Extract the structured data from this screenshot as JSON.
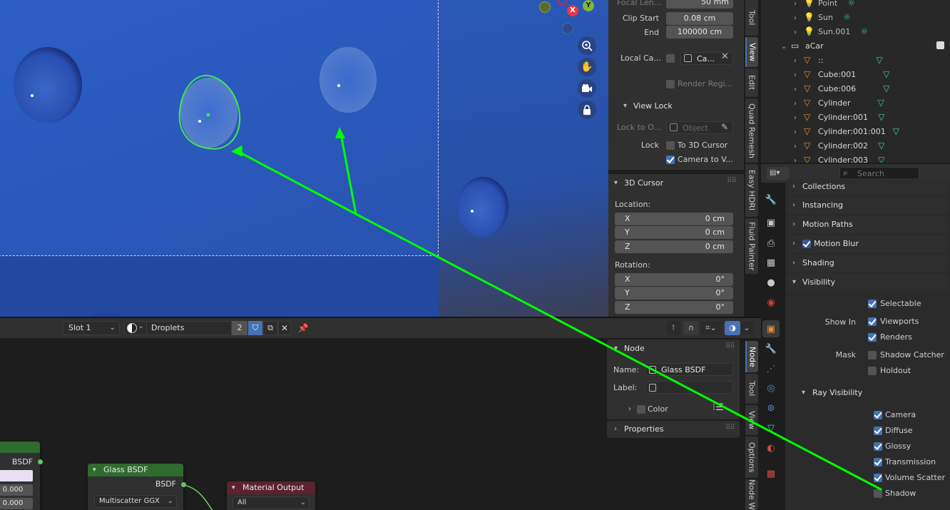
{
  "viewport": {
    "gizmo_x_label": "X",
    "gizmo_y_label": "Y"
  },
  "view_panel": {
    "focal_length_label": "Focal Len...",
    "focal_length_value": "50 mm",
    "clip_start_label": "Clip Start",
    "clip_start_value": "0.08 cm",
    "clip_end_label": "End",
    "clip_end_value": "100000 cm",
    "local_camera_label": "Local Ca...",
    "local_camera_value": "Ca...",
    "render_region_label": "Render Regi...",
    "view_lock_header": "View Lock",
    "lock_to_object_label": "Lock to O...",
    "lock_to_object_placeholder": "Object",
    "lock_label": "Lock",
    "to_3d_cursor_label": "To 3D Cursor",
    "camera_to_view_label": "Camera to V...",
    "cursor_header": "3D Cursor",
    "location_label": "Location:",
    "location": [
      {
        "axis": "X",
        "value": "0 cm"
      },
      {
        "axis": "Y",
        "value": "0 cm"
      },
      {
        "axis": "Z",
        "value": "0 cm"
      }
    ],
    "rotation_label": "Rotation:",
    "rotation": [
      {
        "axis": "X",
        "value": "0°"
      },
      {
        "axis": "Y",
        "value": "0°"
      },
      {
        "axis": "Z",
        "value": "0°"
      }
    ]
  },
  "viewport_tabs": [
    "Tool",
    "View",
    "Edit",
    "Quad Remesh",
    "Easy HDRI",
    "Fluid Painter"
  ],
  "outliner": {
    "items": [
      {
        "name": "Point",
        "kind": "light"
      },
      {
        "name": "Sun",
        "kind": "light"
      },
      {
        "name": "Sun.001",
        "kind": "light"
      },
      {
        "name": "aCar",
        "kind": "collection"
      },
      {
        "name": "::",
        "kind": "mesh"
      },
      {
        "name": "Cube:001",
        "kind": "mesh"
      },
      {
        "name": "Cube:006",
        "kind": "mesh"
      },
      {
        "name": "Cylinder",
        "kind": "mesh"
      },
      {
        "name": "Cylinder:001",
        "kind": "mesh"
      },
      {
        "name": "Cylinder:001:001",
        "kind": "mesh"
      },
      {
        "name": "Cylinder:002",
        "kind": "mesh"
      },
      {
        "name": "Cylinder:003",
        "kind": "mesh"
      }
    ]
  },
  "properties": {
    "search_placeholder": "Search",
    "sections": {
      "collections": "Collections",
      "instancing": "Instancing",
      "motion_paths": "Motion Paths",
      "motion_blur": "Motion Blur",
      "shading": "Shading",
      "visibility": "Visibility"
    },
    "selectable_label": "Selectable",
    "show_in_label": "Show In",
    "viewports_label": "Viewports",
    "renders_label": "Renders",
    "mask_label": "Mask",
    "shadow_catcher_label": "Shadow Catcher",
    "holdout_label": "Holdout",
    "ray_visibility_header": "Ray Visibility",
    "ray": [
      {
        "label": "Camera",
        "checked": true
      },
      {
        "label": "Diffuse",
        "checked": true
      },
      {
        "label": "Glossy",
        "checked": true
      },
      {
        "label": "Transmission",
        "checked": true
      },
      {
        "label": "Volume Scatter",
        "checked": true
      },
      {
        "label": "Shadow",
        "checked": false
      }
    ]
  },
  "node_editor": {
    "slot_label": "Slot 1",
    "material_name": "Droplets",
    "users_count": "2",
    "node_panel_header": "Node",
    "name_label": "Name:",
    "name_value": "Glass BSDF",
    "label_label": "Label:",
    "color_label": "Color",
    "properties_header": "Properties",
    "tabs": [
      "Node",
      "Tool",
      "View",
      "Options",
      "Node W"
    ],
    "left_node_output": "BSDF",
    "left_node_val1": "0.000",
    "left_node_val2": "0.000",
    "glass_node_title": "Glass BSDF",
    "glass_node_output": "BSDF",
    "glass_node_distribution": "Multiscatter GGX",
    "output_node_title": "Material Output",
    "output_node_target": "All"
  },
  "colors": {
    "annotation_green": "#00ff00",
    "checkbox_blue": "#4772b3",
    "node_header_green": "#2f6b2f",
    "output_header_red": "#5c2230"
  }
}
